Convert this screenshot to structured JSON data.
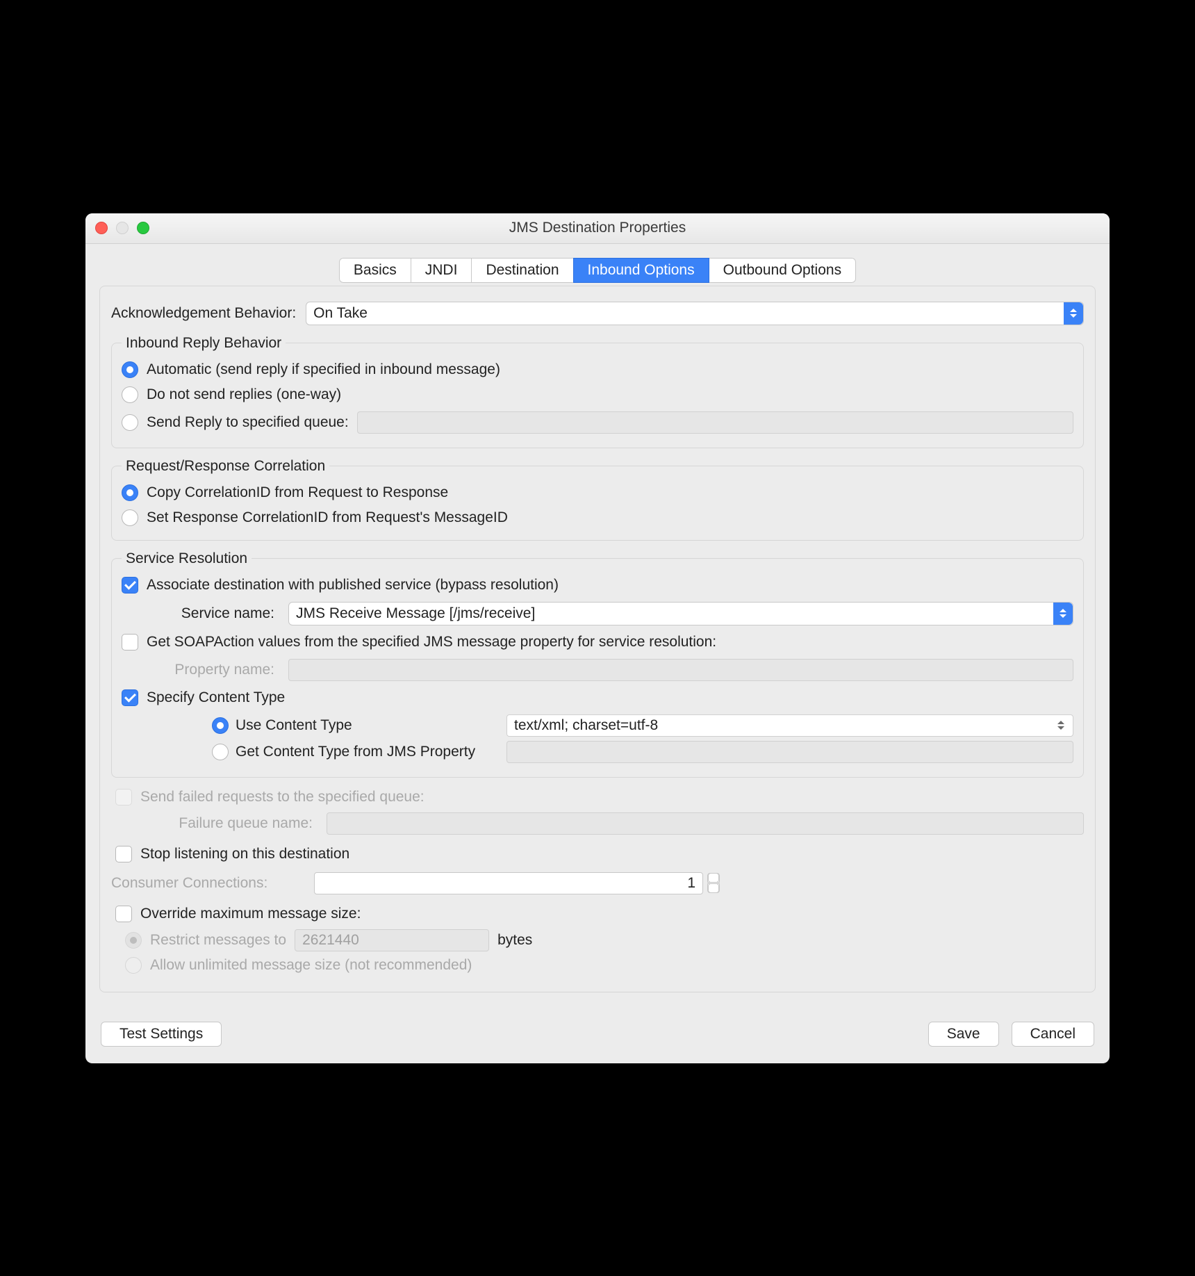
{
  "title": "JMS Destination Properties",
  "tabs": [
    "Basics",
    "JNDI",
    "Destination",
    "Inbound Options",
    "Outbound Options"
  ],
  "active_tab": 3,
  "ack": {
    "label": "Acknowledgement Behavior:",
    "value": "On Take"
  },
  "inbound_reply": {
    "legend": "Inbound Reply Behavior",
    "opt_auto": "Automatic (send reply if specified in inbound message)",
    "opt_noreply": "Do not send replies (one-way)",
    "opt_queue": "Send Reply to specified queue:"
  },
  "correlation": {
    "legend": "Request/Response Correlation",
    "opt_copy": "Copy CorrelationID from Request to Response",
    "opt_set": "Set Response CorrelationID from Request's MessageID"
  },
  "service": {
    "legend": "Service Resolution",
    "assoc": "Associate destination with published service (bypass resolution)",
    "service_name_label": "Service name:",
    "service_name_value": "JMS Receive Message [/jms/receive]",
    "soapaction": "Get SOAPAction values from the specified JMS message property for service resolution:",
    "prop_name_label": "Property name:",
    "specify_ct": "Specify Content Type",
    "use_ct": "Use Content Type",
    "ct_value": "text/xml; charset=utf-8",
    "from_prop": "Get Content Type from JMS Property"
  },
  "failed": {
    "label": "Send failed requests to the specified queue:",
    "queue_label": "Failure queue name:"
  },
  "stop": "Stop listening on this destination",
  "consumer": {
    "label": "Consumer Connections:",
    "value": "1"
  },
  "override": {
    "label": "Override maximum message size:",
    "restrict": "Restrict messages to",
    "bytes_value": "2621440",
    "bytes_unit": "bytes",
    "unlimited": "Allow unlimited message size (not recommended)"
  },
  "buttons": {
    "test": "Test Settings",
    "save": "Save",
    "cancel": "Cancel"
  }
}
